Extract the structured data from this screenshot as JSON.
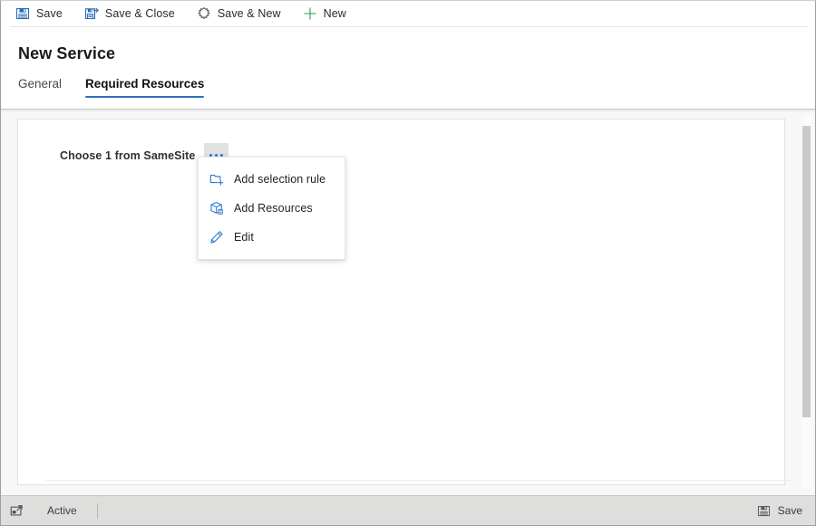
{
  "toolbar": {
    "buttons": [
      {
        "label": "Save",
        "icon": "save-floppy-icon"
      },
      {
        "label": "Save & Close",
        "icon": "save-close-floppy-icon"
      },
      {
        "label": "Save & New",
        "icon": "save-new-icon"
      },
      {
        "label": "New",
        "icon": "plus-icon"
      }
    ]
  },
  "header": {
    "title": "New Service",
    "tabs": [
      {
        "label": "General",
        "active": false
      },
      {
        "label": "Required Resources",
        "active": true
      }
    ]
  },
  "content": {
    "field_label": "Choose 1 from SameSite",
    "ellipsis_button_label": "..."
  },
  "context_menu": {
    "items": [
      {
        "label": "Add selection rule",
        "icon": "add-folder-icon"
      },
      {
        "label": "Add Resources",
        "icon": "add-box-icon"
      },
      {
        "label": "Edit",
        "icon": "pencil-icon"
      }
    ]
  },
  "statusbar": {
    "status": "Active",
    "save_label": "Save",
    "expand_icon": "expand-window-icon",
    "save_icon": "save-floppy-gray-icon"
  },
  "colors": {
    "accent": "#2f6fc4",
    "icon_blue": "#2b7cd3",
    "plus_green": "#4cae6a",
    "statusbar_bg": "#dededd",
    "body_bg": "#f7f7f7"
  }
}
